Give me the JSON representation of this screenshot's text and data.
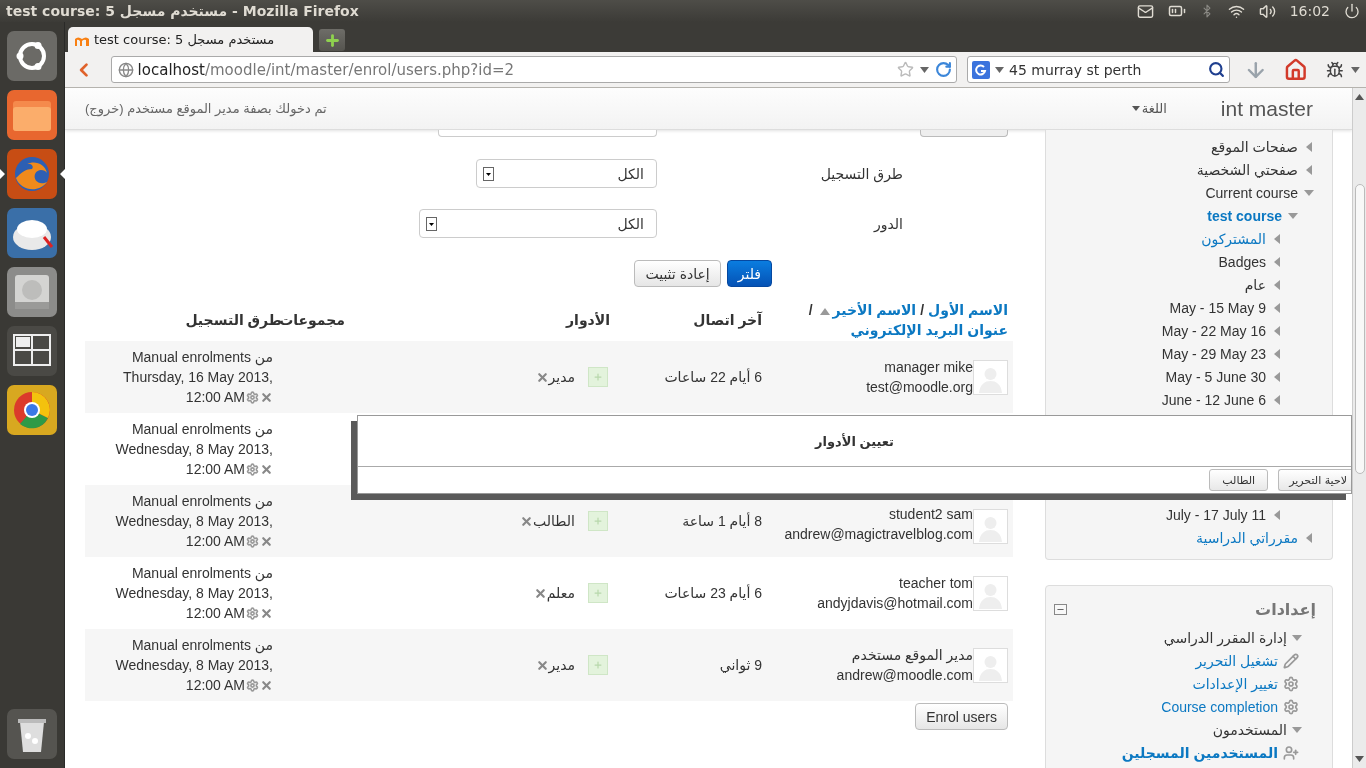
{
  "window": {
    "title": "test course: 5 مستخدم مسجل - Mozilla Firefox"
  },
  "system_tray": {
    "clock": "16:02"
  },
  "launcher": [
    {
      "kind": "dash",
      "active": false
    },
    {
      "kind": "files",
      "active": false
    },
    {
      "kind": "browser",
      "active": true
    },
    {
      "kind": "app",
      "active": false
    },
    {
      "kind": "drive",
      "active": false
    },
    {
      "kind": "workspaces",
      "active": false
    },
    {
      "kind": "round",
      "active": false
    },
    {
      "kind": "trash",
      "active": false
    }
  ],
  "tabs": [
    {
      "label": "test course: 5 مستخدم مسجل",
      "selected": true
    }
  ],
  "address_bar": {
    "host": "localhost",
    "path": "/moodle/int/master/enrol/users.php?id=2"
  },
  "search_bar": {
    "value": "45 murray st perth"
  },
  "header": {
    "site_name": "int master",
    "language_menu": "اللغة",
    "login_text": "تم دخولك بصفة مدير الموقع مستخدم",
    "logout_link": "(خروج)"
  },
  "filters": [
    {
      "label": "طرق التسجيل",
      "value": "الكل"
    },
    {
      "label": "الدور",
      "value": "الكل"
    }
  ],
  "filter_buttons": [
    {
      "label": "فلتر",
      "kind": "primary"
    },
    {
      "label": "إعادة تثبيت",
      "kind": "default"
    }
  ],
  "table": {
    "name_header": [
      {
        "kind": "link",
        "text": "الاسم الأول",
        "sorted": false
      },
      {
        "kind": "separator",
        "text": "/"
      },
      {
        "kind": "link",
        "text": "الاسم الأخير",
        "sorted": true
      },
      {
        "kind": "separator",
        "text": "/"
      },
      {
        "kind": "link",
        "text": "عنوان البريد الإلكتروني",
        "sorted": false
      }
    ],
    "columns": [
      "آخر اتصال",
      "الأدوار",
      "مجموعات",
      "طرق التسجيل"
    ],
    "rows": [
      {
        "name": "manager mike",
        "email": "test@moodle.org",
        "last_access": "6 أيام 22 ساعات",
        "roles": [
          "مدير"
        ],
        "enrolment": [
          "Manual enrolments من",
          "Thursday, 16 May 2013,",
          "12:00 AM"
        ]
      },
      {
        "enrolment": [
          "Manual enrolments من",
          "Wednesday, 8 May 2013,",
          "12:00 AM"
        ]
      },
      {
        "name": "student2 sam",
        "email": "andrew@magictravelblog.com",
        "last_access": "8 أيام 1 ساعة",
        "roles": [
          "الطالب"
        ],
        "enrolment": [
          "Manual enrolments من",
          "Wednesday, 8 May 2013,",
          "12:00 AM"
        ]
      },
      {
        "name": "teacher tom",
        "email": "andyjdavis@hotmail.com",
        "last_access": "6 أيام 23 ساعات",
        "roles": [
          "معلم"
        ],
        "enrolment": [
          "Manual enrolments من",
          "Wednesday, 8 May 2013,",
          "12:00 AM"
        ]
      },
      {
        "name": "مدير الموقع مستخدم",
        "email": "andrew@moodle.com",
        "last_access": "9 ثواني",
        "roles": [
          "مدير"
        ],
        "enrolment": [
          "Manual enrolments من",
          "Wednesday, 8 May 2013,",
          "12:00 AM"
        ]
      }
    ]
  },
  "enrol_button": "Enrol users",
  "dialog": {
    "title": "تعيين الأدوار",
    "buttons": [
      "لاحية التحرير",
      "الطالب"
    ]
  },
  "navigation": {
    "items": [
      {
        "label": "صفحات الموقع",
        "kind": "plain",
        "expanded": false
      },
      {
        "label": "صفحتي الشخصية",
        "kind": "plain",
        "expanded": false
      },
      {
        "label": "Current course",
        "kind": "plain",
        "expanded": true,
        "children": [
          {
            "label": "test course",
            "kind": "course",
            "expanded": true,
            "children": [
              {
                "label": "المشتركون",
                "kind": "link",
                "expanded": false
              },
              {
                "label": "Badges",
                "kind": "plain",
                "expanded": false
              },
              {
                "label": "عام",
                "kind": "plain",
                "expanded": false
              },
              {
                "label": "May - 15 May 9",
                "kind": "plain",
                "expanded": false
              },
              {
                "label": "May - 22 May 16",
                "kind": "plain",
                "expanded": false
              },
              {
                "label": "May - 29 May 23",
                "kind": "plain",
                "expanded": false
              },
              {
                "label": "May - 5 June 30",
                "kind": "plain",
                "expanded": false
              },
              {
                "label": "June - 12 June 6",
                "kind": "plain",
                "expanded": false
              },
              {
                "label": "July - 17 July 11",
                "kind": "plain",
                "expanded": false,
                "gap_before": true
              }
            ]
          }
        ]
      },
      {
        "label": "مقرراتي الدراسية",
        "kind": "link",
        "expanded": false
      }
    ]
  },
  "settings": {
    "title": "إعدادات",
    "items": [
      {
        "label": "إدارة المقرر الدراسي",
        "kind": "branch",
        "expanded": true,
        "children": [
          {
            "label": "تشغيل التحرير",
            "kind": "edit"
          },
          {
            "label": "تغيير الإعدادات",
            "kind": "setting"
          },
          {
            "label": "Course completion",
            "kind": "setting"
          }
        ]
      },
      {
        "label": "المستخدمون",
        "kind": "branch",
        "expanded": true,
        "children": [
          {
            "label": "المستخدمين المسجلين",
            "kind": "users"
          }
        ]
      }
    ]
  }
}
